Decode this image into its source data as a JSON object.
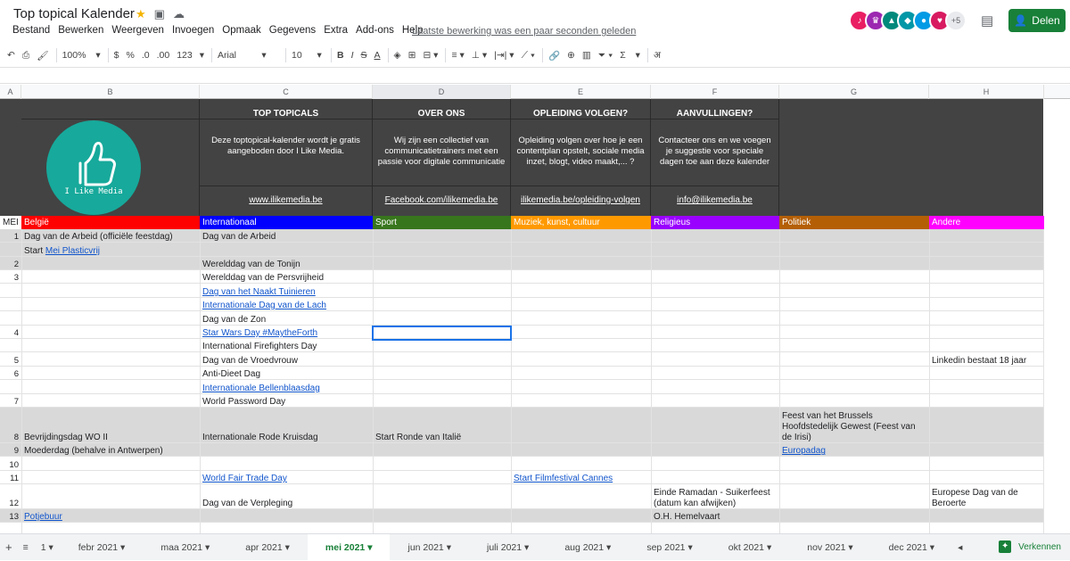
{
  "app": {
    "title": "Top topical Kalender",
    "menu": [
      "Bestand",
      "Bewerken",
      "Weergeven",
      "Invoegen",
      "Opmaak",
      "Gegevens",
      "Extra",
      "Add-ons",
      "Help"
    ],
    "last_edit": "Laatste bewerking was een paar seconden geleden",
    "share_label": "Delen",
    "avatar_more": "+5"
  },
  "toolbar": {
    "zoom": "100%",
    "currency": "$",
    "percent": "%",
    "dec_less": ".0",
    "dec_more": ".00",
    "format": "123",
    "font": "Arial",
    "size": "10",
    "bold": "B",
    "italic": "I",
    "strike": "S",
    "textcolor": "A",
    "sigma": "Σ",
    "input_tool": "अ"
  },
  "columns": [
    "A",
    "B",
    "C",
    "D",
    "E",
    "F",
    "G",
    "H"
  ],
  "header_block": {
    "logo_text": "I Like Media",
    "cols": [
      {
        "title": "TOP TOPICALS",
        "desc": "Deze toptopical-kalender wordt je gratis aangeboden door I Like Media.",
        "link": "www.ilikemedia.be"
      },
      {
        "title": "OVER ONS",
        "desc": "Wij zijn een collectief van communicatietrainers met een passie voor digitale communicatie",
        "link": "Facebook.com/ilikemedia.be"
      },
      {
        "title": "OPLEIDING VOLGEN?",
        "desc": "Opleiding volgen over hoe je een contentplan opstelt, sociale media inzet, blogt, video maakt,... ?",
        "link": "ilikemedia.be/opleiding-volgen"
      },
      {
        "title": "AANVULLINGEN?",
        "desc": "Contacteer ons en we voegen je suggestie voor speciale dagen toe aan deze kalender",
        "link": "info@ilikemedia.be"
      }
    ]
  },
  "categories": {
    "month": "MEI",
    "items": [
      {
        "label": "België",
        "color": "#ff0000"
      },
      {
        "label": "Internationaal",
        "color": "#0000ff"
      },
      {
        "label": "Sport",
        "color": "#38761d"
      },
      {
        "label": "Muziek, kunst, cultuur",
        "color": "#ff9900"
      },
      {
        "label": "Religieus",
        "color": "#9900ff"
      },
      {
        "label": "Politiek",
        "color": "#b45f06"
      },
      {
        "label": "Andere",
        "color": "#ff00ff"
      }
    ]
  },
  "rows": [
    {
      "day": "1",
      "b": "Dag van de Arbeid (officiële feestdag)",
      "c": "Dag van de Arbeid",
      "d": "",
      "e": "",
      "f": "",
      "g": "",
      "h": ""
    },
    {
      "day": "",
      "b": "Start ",
      "b_link": "Mei Plasticvrij",
      "c": "",
      "d": "",
      "e": "",
      "f": "",
      "g": "",
      "h": ""
    },
    {
      "day": "2",
      "b": "",
      "c": "Werelddag van de Tonijn",
      "d": "",
      "e": "",
      "f": "",
      "g": "",
      "h": ""
    },
    {
      "day": "3",
      "b": "",
      "c": "Werelddag van de Persvrijheid",
      "d": "",
      "e": "",
      "f": "",
      "g": "",
      "h": ""
    },
    {
      "day": "",
      "b": "",
      "c_link": "Dag van het Naakt Tuinieren",
      "d": "",
      "e": "",
      "f": "",
      "g": "",
      "h": ""
    },
    {
      "day": "",
      "b": "",
      "c_link": "Internationale Dag van de Lach",
      "d": "",
      "e": "",
      "f": "",
      "g": "",
      "h": ""
    },
    {
      "day": "",
      "b": "",
      "c": "Dag van de Zon",
      "d": "",
      "e": "",
      "f": "",
      "g": "",
      "h": ""
    },
    {
      "day": "4",
      "b": "",
      "c_link": "Star Wars Day #MaytheForth",
      "d": "",
      "e": "",
      "f": "",
      "g": "",
      "h": ""
    },
    {
      "day": "",
      "b": "",
      "c": "International Firefighters Day",
      "d": "",
      "e": "",
      "f": "",
      "g": "",
      "h": ""
    },
    {
      "day": "5",
      "b": "",
      "c": "Dag van de Vroedvrouw",
      "d": "",
      "e": "",
      "f": "",
      "g": "",
      "h": "Linkedin bestaat 18 jaar"
    },
    {
      "day": "6",
      "b": "",
      "c": "Anti-Dieet Dag",
      "d": "",
      "e": "",
      "f": "",
      "g": "",
      "h": ""
    },
    {
      "day": "",
      "b": "",
      "c_link": "Internationale Bellenblaasdag",
      "d": "",
      "e": "",
      "f": "",
      "g": "",
      "h": ""
    },
    {
      "day": "7",
      "b": "",
      "c": "World Password Day",
      "d": "",
      "e": "",
      "f": "",
      "g": "",
      "h": ""
    },
    {
      "day": "8",
      "b": "Bevrijdingsdag WO II",
      "c": "Internationale Rode Kruisdag",
      "d": "Start Ronde van Italië",
      "e": "",
      "f": "",
      "g": "Feest van het Brussels Hoofdstedelijk Gewest (Feest van de Irisi)",
      "h": ""
    },
    {
      "day": "9",
      "b": "Moederdag (behalve in Antwerpen)",
      "c": "",
      "d": "",
      "e": "",
      "f": "",
      "g_link": "Europadag",
      "h": ""
    },
    {
      "day": "10",
      "b": "",
      "c": "",
      "d": "",
      "e": "",
      "f": "",
      "g": "",
      "h": ""
    },
    {
      "day": "11",
      "b": "",
      "c_link": "World Fair Trade Day",
      "d": "",
      "e_link": "Start Filmfestival Cannes",
      "f": "",
      "g": "",
      "h": ""
    },
    {
      "day": "12",
      "b": "",
      "c": "Dag van de Verpleging",
      "d": "",
      "e": "",
      "f": "Einde Ramadan - Suikerfeest (datum kan afwijken)",
      "g": "",
      "h": "Europese Dag van de Beroerte"
    },
    {
      "day": "13",
      "b_link": "Potjebuur",
      "c": "",
      "d": "",
      "e": "",
      "f": "O.H. Hemelvaart",
      "g": "",
      "h": ""
    }
  ],
  "sheet_tabs": [
    "febr 2021",
    "maa 2021",
    "apr 2021",
    "mei 2021",
    "jun 2021",
    "juli 2021",
    "aug 2021",
    "sep 2021",
    "okt 2021",
    "nov 2021",
    "dec 2021"
  ],
  "active_tab": "mei 2021",
  "explore_label": "Verkennen"
}
